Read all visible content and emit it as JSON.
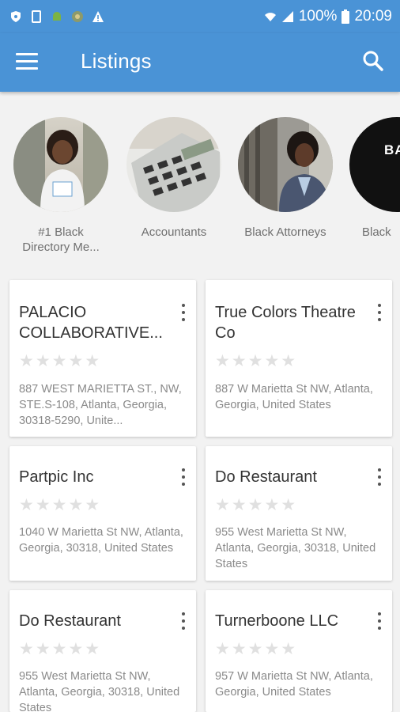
{
  "status": {
    "battery": "100%",
    "time": "20:09"
  },
  "appbar": {
    "title": "Listings"
  },
  "categories": [
    {
      "label": "#1 Black Directory Me..."
    },
    {
      "label": "Accountants"
    },
    {
      "label": "Black Attorneys"
    },
    {
      "label": "Black",
      "badge": "BA"
    }
  ],
  "listings": [
    {
      "name": "PALACIO COLLABORATIVE...",
      "rating": 0,
      "address": "887 WEST MARIETTA ST., NW, STE.S-108, Atlanta, Georgia, 30318-5290, Unite..."
    },
    {
      "name": "True Colors Theatre Co",
      "rating": 0,
      "address": "887 W Marietta St NW, Atlanta, Georgia, United States"
    },
    {
      "name": "Partpic Inc",
      "rating": 0,
      "address": "1040 W Marietta St NW, Atlanta, Georgia, 30318, United States"
    },
    {
      "name": "Do Restaurant",
      "rating": 0,
      "address": "955 West Marietta St NW, Atlanta, Georgia, 30318, United States"
    },
    {
      "name": "Do Restaurant",
      "rating": 0,
      "address": "955 West Marietta St NW, Atlanta, Georgia, 30318, United States"
    },
    {
      "name": "Turnerboone LLC",
      "rating": 0,
      "address": "957 W Marietta St NW, Atlanta, Georgia, United States"
    }
  ],
  "colors": {
    "primary": "#4a93d6",
    "star_empty": "#e0e0e0"
  }
}
